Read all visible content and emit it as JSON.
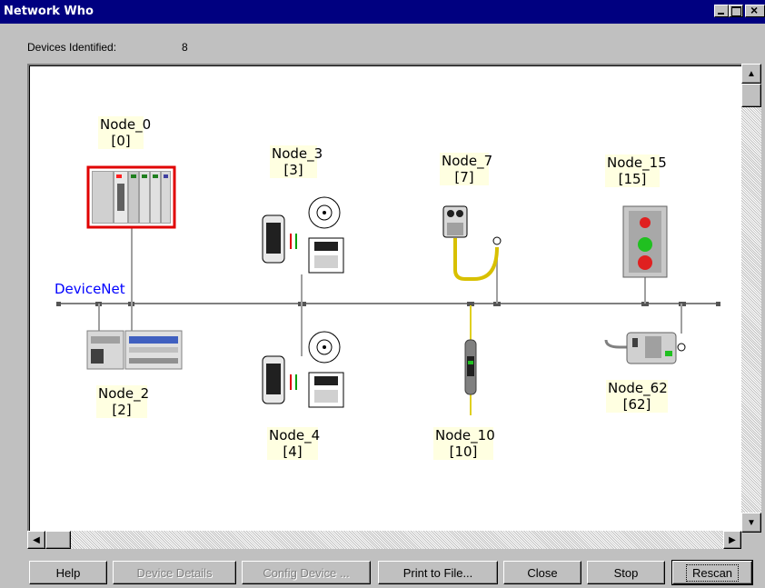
{
  "window": {
    "title": "Network Who"
  },
  "info": {
    "devices_label": "Devices Identified:",
    "devices_count": "8"
  },
  "network": {
    "name": "DeviceNet"
  },
  "nodes": [
    {
      "name": "Node_0",
      "address": "[0]"
    },
    {
      "name": "Node_3",
      "address": "[3]"
    },
    {
      "name": "Node_7",
      "address": "[7]"
    },
    {
      "name": "Node_15",
      "address": "[15]"
    },
    {
      "name": "Node_2",
      "address": "[2]"
    },
    {
      "name": "Node_4",
      "address": "[4]"
    },
    {
      "name": "Node_10",
      "address": "[10]"
    },
    {
      "name": "Node_62",
      "address": "[62]"
    }
  ],
  "buttons": {
    "help": "Help",
    "device_details": "Device Details",
    "config_device": "Config Device ...",
    "print_to_file": "Print to File...",
    "close": "Close",
    "stop": "Stop",
    "rescan": "Rescan"
  },
  "colors": {
    "titlebar": "#000080",
    "network_label": "#0000ff",
    "selected_border": "#e00000",
    "label_bg": "#ffffe1"
  }
}
